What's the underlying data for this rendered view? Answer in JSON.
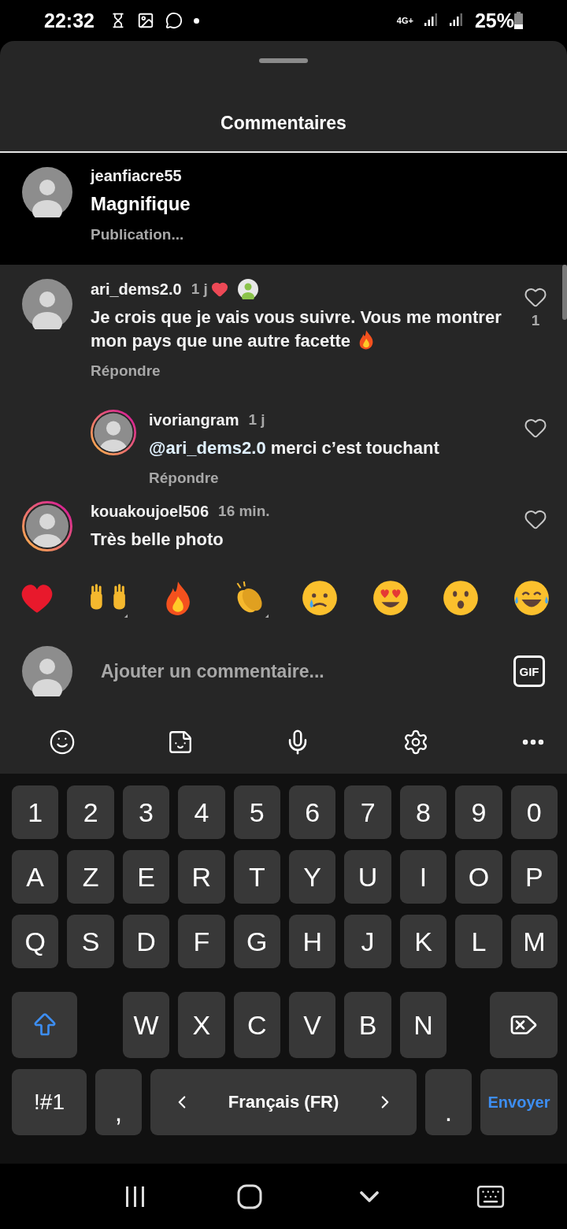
{
  "status_bar": {
    "time": "22:32",
    "network": "4G+",
    "battery": "25%"
  },
  "sheet": {
    "title": "Commentaires"
  },
  "highlighted_comment": {
    "username": "jeanfiacre55",
    "text": "Magnifique",
    "status": "Publication..."
  },
  "comments": [
    {
      "username": "ari_dems2.0",
      "time": "1 j",
      "liked_by_author": true,
      "story_ring": false,
      "text": "Je crois que je vais vous suivre. Vous me montrer mon pays que une autre facette",
      "fire_emoji": true,
      "reply_label": "Répondre",
      "likes": "1",
      "children": [
        {
          "username": "ivoriangram",
          "time": "1 j",
          "liked_by_author": false,
          "story_ring": true,
          "mention": "@ari_dems2.0",
          "text": "merci c’est touchant",
          "fire_emoji": false,
          "reply_label": "Répondre"
        }
      ]
    },
    {
      "username": "kouakoujoel506",
      "time": "16 min.",
      "liked_by_author": false,
      "story_ring": true,
      "text": "Très belle photo",
      "fire_emoji": false
    }
  ],
  "composer": {
    "placeholder": "Ajouter un commentaire...",
    "gif_label": "GIF"
  },
  "keyboard": {
    "rows": [
      [
        {
          "kind": "char",
          "label": "1"
        },
        {
          "kind": "char",
          "label": "2"
        },
        {
          "kind": "char",
          "label": "3"
        },
        {
          "kind": "char",
          "label": "4"
        },
        {
          "kind": "char",
          "label": "5"
        },
        {
          "kind": "char",
          "label": "6"
        },
        {
          "kind": "char",
          "label": "7"
        },
        {
          "kind": "char",
          "label": "8"
        },
        {
          "kind": "char",
          "label": "9"
        },
        {
          "kind": "char",
          "label": "0"
        }
      ],
      [
        {
          "kind": "char",
          "label": "A"
        },
        {
          "kind": "char",
          "label": "Z"
        },
        {
          "kind": "char",
          "label": "E"
        },
        {
          "kind": "char",
          "label": "R"
        },
        {
          "kind": "char",
          "label": "T"
        },
        {
          "kind": "char",
          "label": "Y"
        },
        {
          "kind": "char",
          "label": "U"
        },
        {
          "kind": "char",
          "label": "I"
        },
        {
          "kind": "char",
          "label": "O"
        },
        {
          "kind": "char",
          "label": "P"
        }
      ],
      [
        {
          "kind": "char",
          "label": "Q"
        },
        {
          "kind": "char",
          "label": "S"
        },
        {
          "kind": "char",
          "label": "D"
        },
        {
          "kind": "char",
          "label": "F"
        },
        {
          "kind": "char",
          "label": "G"
        },
        {
          "kind": "char",
          "label": "H"
        },
        {
          "kind": "char",
          "label": "J"
        },
        {
          "kind": "char",
          "label": "K"
        },
        {
          "kind": "char",
          "label": "L"
        },
        {
          "kind": "char",
          "label": "M"
        }
      ],
      [
        {
          "kind": "shift"
        },
        "",
        {
          "kind": "char",
          "label": "W"
        },
        {
          "kind": "char",
          "label": "X"
        },
        {
          "kind": "char",
          "label": "C"
        },
        {
          "kind": "char",
          "label": "V"
        },
        {
          "kind": "char",
          "label": "B"
        },
        {
          "kind": "char",
          "label": "N"
        },
        "",
        {
          "kind": "backspace"
        }
      ]
    ],
    "bottom_row": [
      {
        "kind": "symbols",
        "label": "!#1"
      },
      {
        "kind": "punct",
        "label": ","
      },
      {
        "kind": "space",
        "label": "Français (FR)"
      },
      {
        "kind": "punct",
        "label": "."
      },
      {
        "kind": "action",
        "label": "Envoyer"
      }
    ]
  }
}
